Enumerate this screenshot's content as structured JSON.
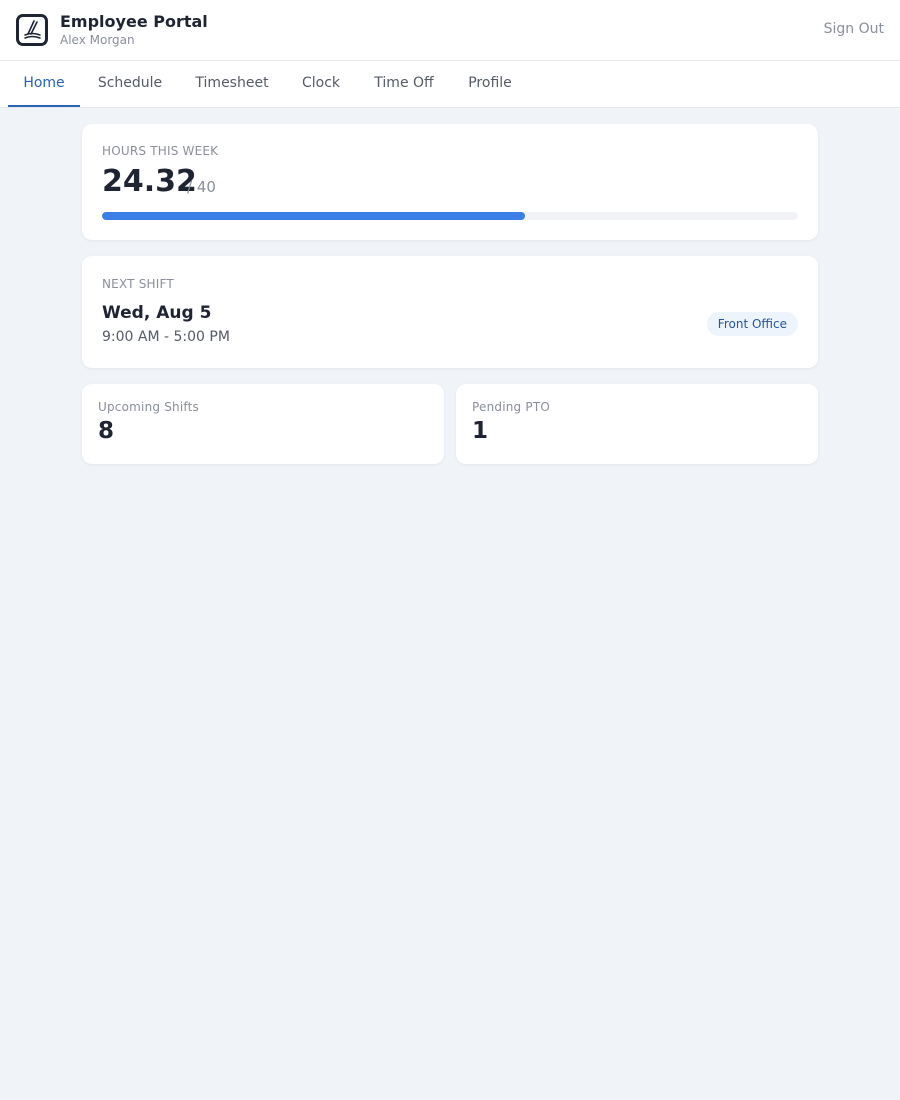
{
  "header": {
    "app_title": "Employee Portal",
    "user_name": "Alex Morgan",
    "sign_out_label": "Sign Out",
    "logo_icon": "portal-logo-icon"
  },
  "tabs": [
    {
      "label": "Home",
      "active": true
    },
    {
      "label": "Schedule",
      "active": false
    },
    {
      "label": "Timesheet",
      "active": false
    },
    {
      "label": "Clock",
      "active": false
    },
    {
      "label": "Time Off",
      "active": false
    },
    {
      "label": "Profile",
      "active": false
    }
  ],
  "hours": {
    "label": "HOURS THIS WEEK",
    "value": "24.32",
    "max_text": "/ 40",
    "progress_fraction": 0.608
  },
  "next_shift": {
    "label": "NEXT SHIFT",
    "date": "Wed, Aug 5",
    "time": "9:00 AM - 5:00 PM",
    "location": "Front Office"
  },
  "stats": {
    "upcoming_shifts": {
      "label": "Upcoming Shifts",
      "value": "8"
    },
    "pending_pto": {
      "label": "Pending PTO",
      "value": "1"
    }
  },
  "colors": {
    "accent": "#2563b8",
    "progress": "#3b7fe6",
    "background": "#f0f4f8"
  }
}
